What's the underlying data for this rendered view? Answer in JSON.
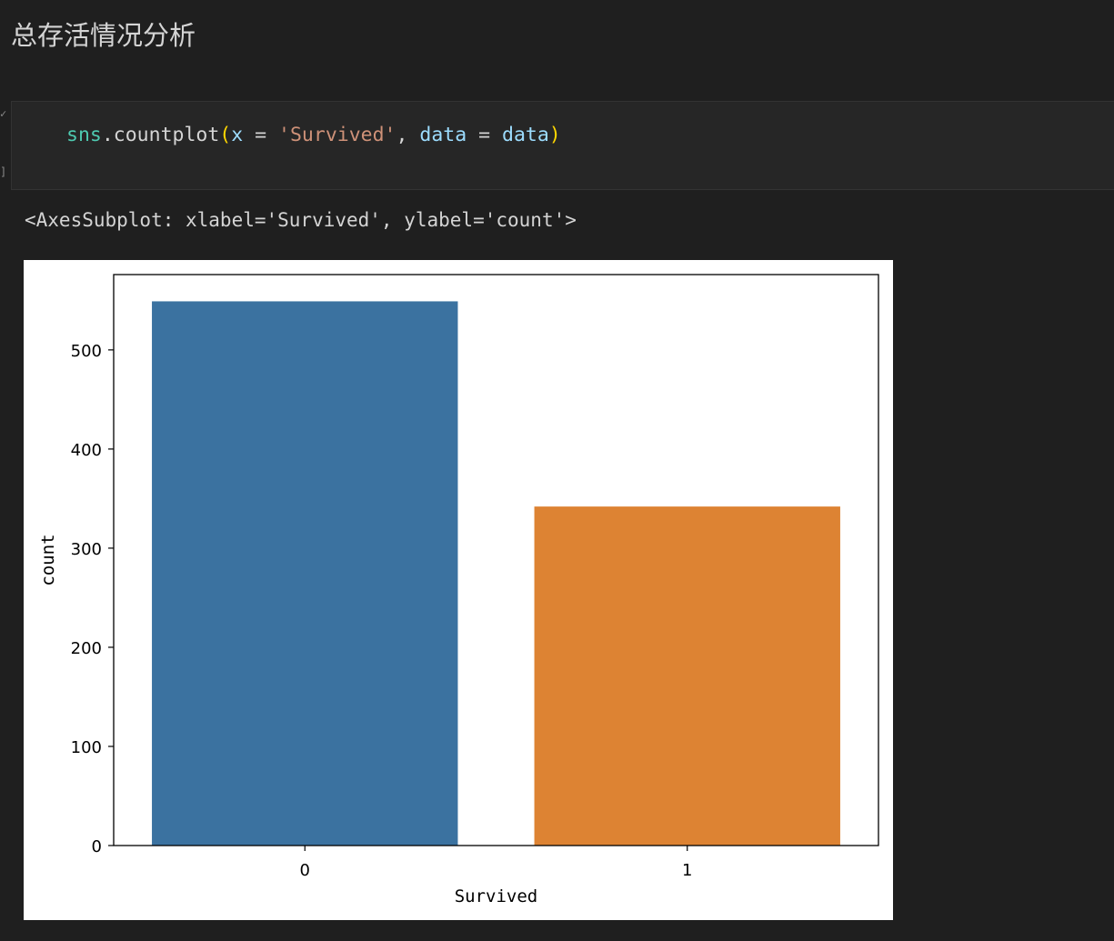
{
  "markdown": {
    "heading": "总存活情况分析"
  },
  "cell": {
    "gutter_top": "✓",
    "gutter_bottom": "]",
    "code": {
      "module": "sns",
      "dot": ".",
      "func": "countplot",
      "open": "(",
      "p1": "x",
      "eq1": " = ",
      "s1": "'Survived'",
      "comma": ", ",
      "p2": "data",
      "eq2": " = ",
      "v2": "data",
      "close": ")"
    }
  },
  "output": {
    "repr": "<AxesSubplot: xlabel='Survived', ylabel='count'>"
  },
  "chart_data": {
    "type": "bar",
    "categories": [
      "0",
      "1"
    ],
    "values": [
      549,
      342
    ],
    "colors": [
      "#3b72a0",
      "#dd8333"
    ],
    "xlabel": "Survived",
    "ylabel": "count",
    "yticks": [
      0,
      100,
      200,
      300,
      400,
      500
    ],
    "ylim": [
      0,
      576
    ],
    "grid": false,
    "legend": "none"
  }
}
